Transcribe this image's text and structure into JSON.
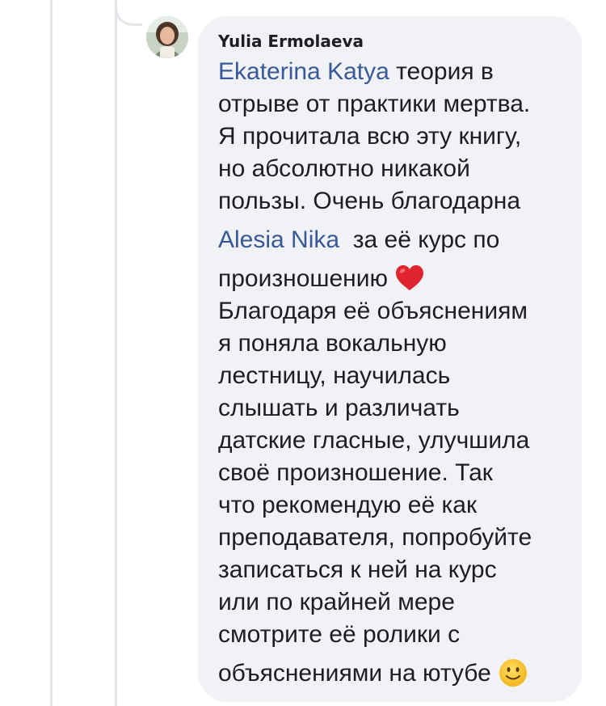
{
  "comment": {
    "author": "Yulia Ermolaeva",
    "body": {
      "mention_1": "Ekaterina Katya",
      "line_1_text": " теория в",
      "line_2": "отрыве от практики мертва.",
      "line_3": "Я прочитала всю эту книгу,",
      "line_4": "но абсолютно никакой",
      "line_5": "пользы. Очень благодарна",
      "mention_2": "Alesia Nika",
      "line_6_text": "  за её курс по",
      "line_7": "произношению",
      "line_8": "Благодаря её объяснениям",
      "line_9": "я поняла вокальную",
      "line_10": "лестницу, научилась",
      "line_11": "слышать и различать",
      "line_12": "датские гласные, улучшила",
      "line_13": "своё произношение. Так",
      "line_14": "что рекомендую её как",
      "line_15": "преподавателя, попробуйте",
      "line_16": "записаться к ней на курс",
      "line_17": "или по крайней мере",
      "line_18": "смотрите её ролики с",
      "line_19": "объяснениями на ютубе"
    },
    "emoji": {
      "heart": "red-heart-icon",
      "smile": "slightly-smiling-face-icon"
    }
  },
  "colors": {
    "bubble_bg": "#f0f2f5",
    "text": "#1c1e21",
    "mention": "#385898",
    "thread_line": "#e4e6eb",
    "heart": "#e0242f",
    "smile": "#f7c531"
  }
}
